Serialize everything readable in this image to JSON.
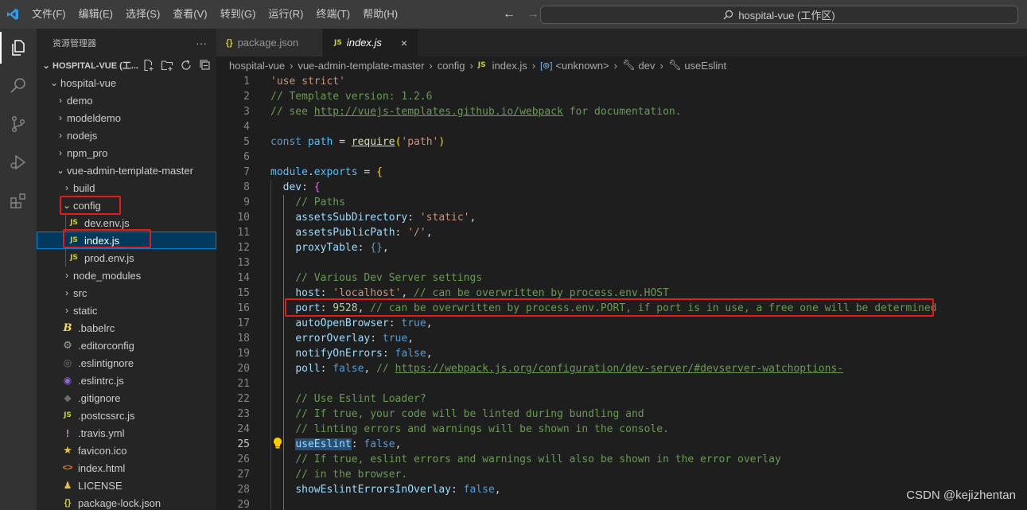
{
  "titlebar": {
    "menu": [
      "文件(F)",
      "编辑(E)",
      "选择(S)",
      "查看(V)",
      "转到(G)",
      "运行(R)",
      "终端(T)",
      "帮助(H)"
    ],
    "search": "hospital-vue (工作区)"
  },
  "sidebar": {
    "title": "资源管理器",
    "more": "···",
    "root": "HOSPITAL-VUE (工...",
    "items": [
      {
        "label": "hospital-vue",
        "type": "folder-open"
      },
      {
        "label": "demo",
        "type": "folder"
      },
      {
        "label": "modeldemo",
        "type": "folder"
      },
      {
        "label": "nodejs",
        "type": "folder"
      },
      {
        "label": "npm_pro",
        "type": "folder"
      },
      {
        "label": "vue-admin-template-master",
        "type": "folder-open"
      },
      {
        "label": "build",
        "type": "folder"
      },
      {
        "label": "config",
        "type": "folder-open"
      },
      {
        "label": "dev.env.js",
        "type": "js"
      },
      {
        "label": "index.js",
        "type": "js"
      },
      {
        "label": "prod.env.js",
        "type": "js"
      },
      {
        "label": "node_modules",
        "type": "folder"
      },
      {
        "label": "src",
        "type": "folder"
      },
      {
        "label": "static",
        "type": "folder"
      },
      {
        "label": ".babelrc",
        "type": "babel"
      },
      {
        "label": ".editorconfig",
        "type": "gear"
      },
      {
        "label": ".eslintignore",
        "type": "eslint-ignore"
      },
      {
        "label": ".eslintrc.js",
        "type": "eslint"
      },
      {
        "label": ".gitignore",
        "type": "git"
      },
      {
        "label": ".postcssrc.js",
        "type": "js"
      },
      {
        "label": ".travis.yml",
        "type": "yml"
      },
      {
        "label": "favicon.ico",
        "type": "star"
      },
      {
        "label": "index.html",
        "type": "html"
      },
      {
        "label": "LICENSE",
        "type": "license"
      },
      {
        "label": "package-lock.json",
        "type": "json"
      }
    ],
    "js_badge": "JS",
    "json_badge": "{}"
  },
  "tabs": [
    {
      "label": "package.json",
      "icon": "{}"
    },
    {
      "label": "index.js",
      "icon": "JS",
      "close": "×"
    }
  ],
  "breadcrumbs": [
    "hospital-vue",
    "vue-admin-template-master",
    "config",
    "index.js",
    "<unknown>",
    "dev",
    "useEslint"
  ],
  "code": {
    "line_numbers": [
      "1",
      "2",
      "3",
      "4",
      "5",
      "6",
      "7",
      "8",
      "9",
      "10",
      "11",
      "12",
      "13",
      "14",
      "15",
      "16",
      "17",
      "18",
      "19",
      "20",
      "21",
      "22",
      "23",
      "24",
      "25",
      "26",
      "27",
      "28",
      "29"
    ],
    "l1": "'use strict'",
    "l2": "// Template version: 1.2.6",
    "l3a": "// see ",
    "l3b": "http://vuejs-templates.github.io/webpack",
    "l3c": " for documentation.",
    "l5a": "const",
    "l5b": "path",
    "l5c": "require",
    "l5d": "'path'",
    "l7a": "module",
    "l7b": "exports",
    "l8": "dev",
    "l9": "// Paths",
    "l10a": "assetsSubDirectory",
    "l10b": "'static'",
    "l11a": "assetsPublicPath",
    "l11b": "'/'",
    "l12": "proxyTable",
    "l14": "// Various Dev Server settings",
    "l15a": "host",
    "l15b": "'localhost'",
    "l15c": "// can be overwritten by process.env.HOST",
    "l16a": "port",
    "l16b": "9528",
    "l16c": "// can be overwritten by process.env.PORT, if port is in use, a free one will be determined",
    "l17a": "autoOpenBrowser",
    "l17b": "true",
    "l18a": "errorOverlay",
    "l18b": "true",
    "l19a": "notifyOnErrors",
    "l19b": "false",
    "l20a": "poll",
    "l20b": "false",
    "l20c": "// ",
    "l20d": "https://webpack.js.org/configuration/dev-server/#devserver-watchoptions-",
    "l22": "// Use Eslint Loader?",
    "l23": "// If true, your code will be linted during bundling and",
    "l24": "// linting errors and warnings will be shown in the console.",
    "l25a": "useEslint",
    "l25b": "false",
    "l26": "// If true, eslint errors and warnings will also be shown in the error overlay",
    "l27": "// in the browser.",
    "l28a": "showEslintErrorsInOverlay",
    "l28b": "false"
  },
  "watermark": "CSDN @kejizhentan",
  "colors": {
    "highlight": "#e41b1b",
    "selection": "#04395e",
    "accent": "#007acc"
  }
}
